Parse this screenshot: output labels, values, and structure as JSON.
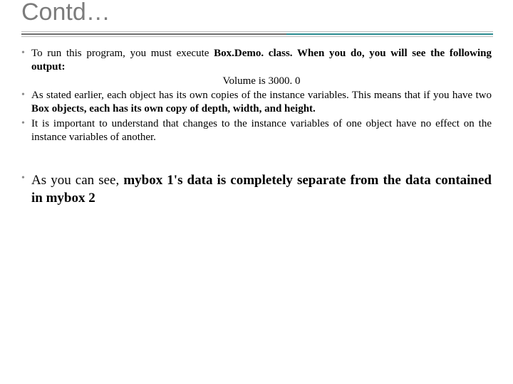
{
  "title": "Contd…",
  "bullets": [
    {
      "pre": "To run this program, you must execute ",
      "bold1": "Box.Demo. class. When you do, you will see the following output:",
      "output": "Volume is 3000. 0"
    },
    {
      "pre2": "As stated earlier, each object has its own copies of the instance variables. This means that if you have two ",
      "bold2": "Box objects, each has its own copy of depth, width, and height."
    },
    {
      "plain": "It is important to understand that changes to the instance variables of one object have no effect on the instance variables of another."
    }
  ],
  "summary": {
    "pre": "As you can see, ",
    "bold": "mybox 1's data is completely separate from the data contained in mybox 2"
  }
}
